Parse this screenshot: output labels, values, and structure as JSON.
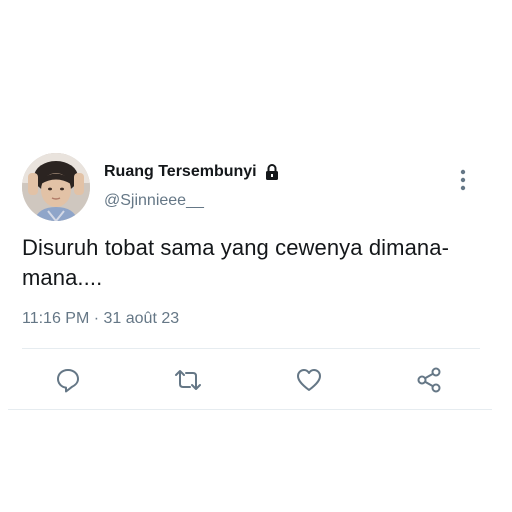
{
  "tweet": {
    "display_name": "Ruang Tersembunyi",
    "handle": "@Sjinnieee__",
    "text": "Disuruh tobat sama yang cewenya dimana-mana....",
    "timestamp": "11:16 PM · 31 août 23",
    "protected_icon": "lock-icon",
    "avatar": "avatar"
  },
  "actions": {
    "reply_icon": "reply-icon",
    "retweet_icon": "retweet-icon",
    "like_icon": "heart-icon",
    "share_icon": "share-icon",
    "more_icon": "more-vertical-icon"
  },
  "colors": {
    "text_primary": "#14171a",
    "text_secondary": "#657786",
    "icon": "#657786",
    "divider": "#e6ecf0"
  }
}
